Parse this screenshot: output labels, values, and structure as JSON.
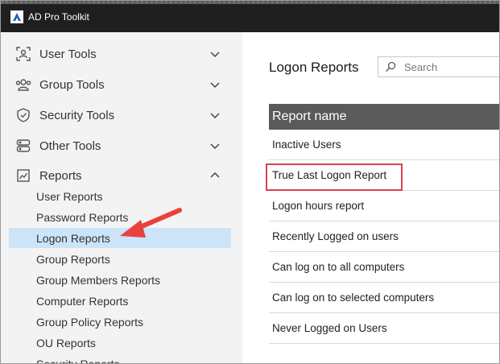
{
  "app": {
    "title": "AD Pro Toolkit"
  },
  "sidebar": {
    "categories": [
      {
        "label": "User Tools",
        "icon": "user-scan-icon"
      },
      {
        "label": "Group Tools",
        "icon": "group-icon"
      },
      {
        "label": "Security Tools",
        "icon": "shield-icon"
      },
      {
        "label": "Other Tools",
        "icon": "server-icon"
      },
      {
        "label": "Reports",
        "icon": "chart-icon"
      }
    ],
    "report_items": [
      "User Reports",
      "Password Reports",
      "Logon Reports",
      "Group Reports",
      "Group Members Reports",
      "Computer Reports",
      "Group Policy Reports",
      "OU Reports",
      "Security Reports"
    ],
    "active_item": "Logon Reports"
  },
  "main": {
    "title": "Logon Reports",
    "search": {
      "placeholder": "Search"
    },
    "table": {
      "header": "Report name",
      "rows": [
        "Inactive Users",
        "True Last Logon Report",
        "Logon hours report",
        "Recently Logged on users",
        "Can log on to all computers",
        "Can log on to selected computers",
        "Never Logged on Users"
      ],
      "highlighted_row": "True Last Logon Report"
    }
  },
  "colors": {
    "titlebar": "#1f1f1f",
    "sidebar_bg": "#f3f3f3",
    "active_item_bg": "#cce4f7",
    "table_header_bg": "#5a5a5a",
    "highlight_border": "#d94050",
    "arrow": "#e8423e"
  }
}
